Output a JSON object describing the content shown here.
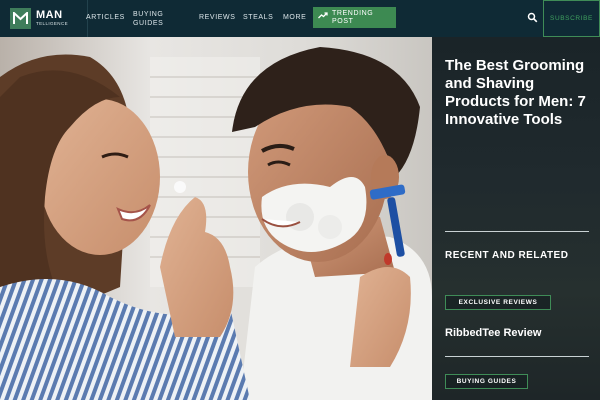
{
  "brand": {
    "name": "MAN",
    "tagline": "TELLIGENCE",
    "accent": "#3f8c57"
  },
  "nav": {
    "items": [
      {
        "label": "ARTICLES"
      },
      {
        "line1": "BUYING",
        "line2": "GUIDES"
      },
      {
        "label": "REVIEWS"
      },
      {
        "label": "STEALS"
      },
      {
        "label": "MORE"
      }
    ],
    "trending": {
      "line1": "TRENDING",
      "line2": "POST",
      "icon": "trending-up-icon"
    },
    "search_icon": "search-icon",
    "subscribe": "SUBSCRIBE"
  },
  "hero": {
    "description_icon": "hero-photo"
  },
  "sidebar": {
    "headline": "The Best Grooming and Shaving Products for Men: 7 Innovative Tools",
    "section_title": "RECENT AND RELATED",
    "tags": [
      "EXCLUSIVE REVIEWS",
      "BUYING GUIDES"
    ],
    "article_title": "RibbedTee Review"
  },
  "colors": {
    "nav_bg": "#0f2a35",
    "accent_green": "#3d8a52",
    "sidebar_bg": "#1f292c"
  }
}
